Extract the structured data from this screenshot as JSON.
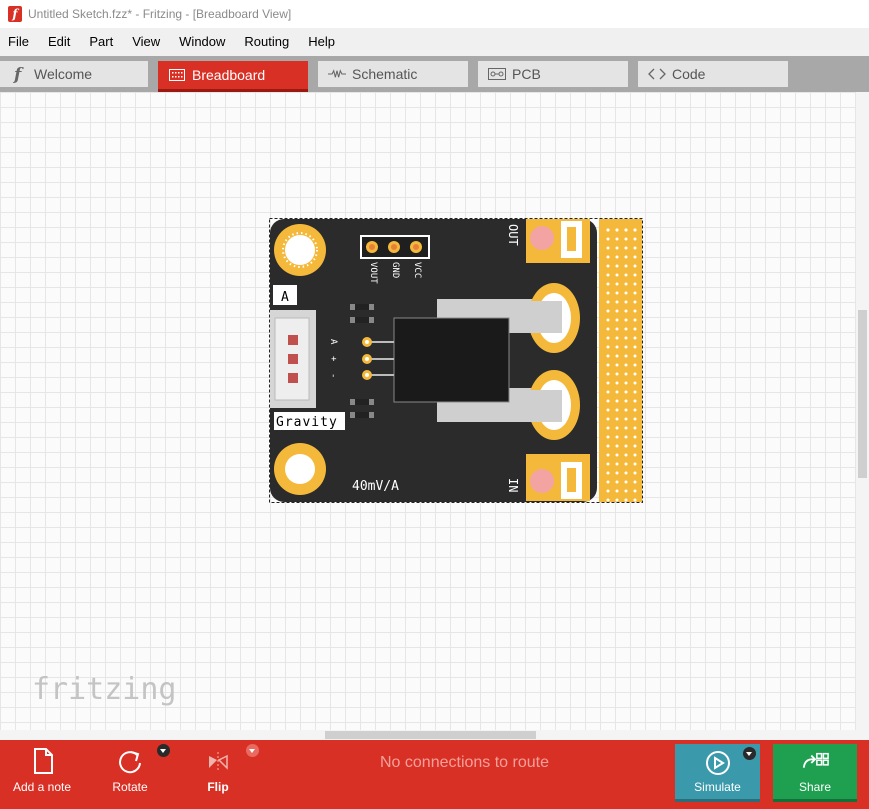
{
  "window": {
    "title": "Untitled Sketch.fzz* - Fritzing - [Breadboard View]",
    "app_icon_glyph": "f"
  },
  "menu": [
    "File",
    "Edit",
    "Part",
    "View",
    "Window",
    "Routing",
    "Help"
  ],
  "tabs": [
    {
      "label": "Welcome",
      "icon": "fritzing-f-icon",
      "active": false
    },
    {
      "label": "Breadboard",
      "icon": "breadboard-icon",
      "active": true
    },
    {
      "label": "Schematic",
      "icon": "resistor-icon",
      "active": false
    },
    {
      "label": "PCB",
      "icon": "pcb-icon",
      "active": false
    },
    {
      "label": "Code",
      "icon": "code-brackets-icon",
      "active": false
    }
  ],
  "canvas": {
    "watermark": "fritzing"
  },
  "board": {
    "pin_labels": [
      "VOUT",
      "GND",
      "VCC"
    ],
    "connector_label": "A",
    "connector_pins": [
      "A",
      "+",
      "-"
    ],
    "brand_label": "Gravity",
    "spec_label": "40mV/A",
    "terminal_out": "OUT",
    "terminal_in": "IN",
    "colors": {
      "pcb": "#2b2b2b",
      "pad": "#f4b93b",
      "accent": "#d93025"
    }
  },
  "toolbar": {
    "add_note": "Add a note",
    "rotate": "Rotate",
    "flip": "Flip",
    "status": "No connections to route",
    "simulate": "Simulate",
    "share": "Share"
  }
}
